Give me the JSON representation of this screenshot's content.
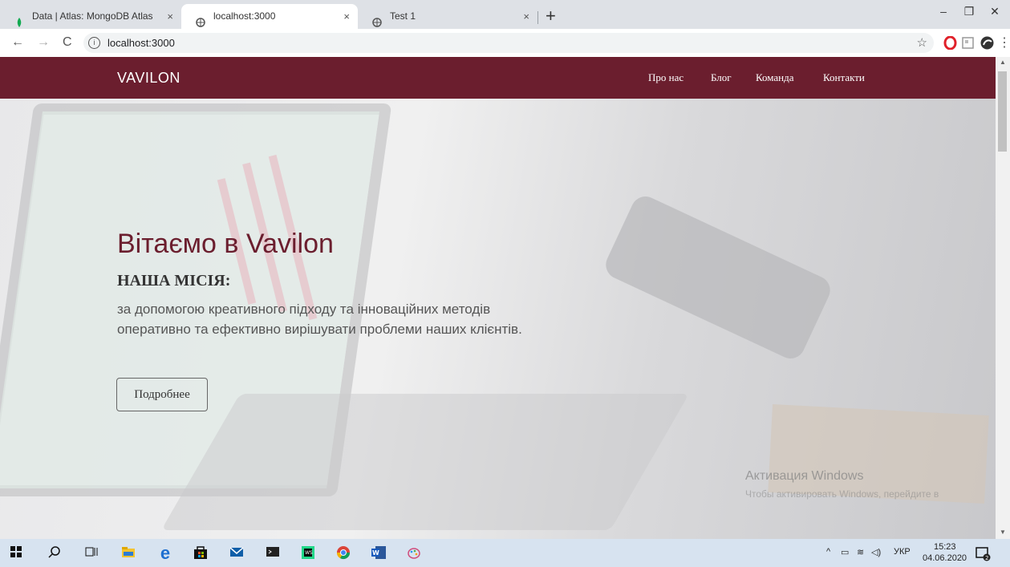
{
  "browser": {
    "tabs": [
      {
        "title": "Data | Atlas: MongoDB Atlas",
        "active": false
      },
      {
        "title": "localhost:3000",
        "active": true
      },
      {
        "title": "Test 1",
        "active": false
      }
    ],
    "new_tab_symbol": "+",
    "url": "localhost:3000",
    "close_symbol": "×",
    "window_controls": {
      "minimize": "–",
      "restore": "❐",
      "close": "✕"
    },
    "nav": {
      "back": "←",
      "forward": "→",
      "reload": "C"
    }
  },
  "page": {
    "brand": "VAVILON",
    "nav_links": [
      "Про нас",
      "Блог",
      "Команда",
      "Контакти"
    ],
    "hero_title": "Вітаємо в Vavilon",
    "mission_title": "НАША МІСІЯ:",
    "mission_text": "за допомогою креативного підходу та інноваційних методів оперативно та ефективно вирішувати проблеми наших клієнтів.",
    "more_button": "Подробнее",
    "colors": {
      "brand": "#6b1e2e"
    }
  },
  "watermark": {
    "title": "Активация Windows",
    "subtitle": "Чтобы активировать Windows, перейдите в"
  },
  "taskbar": {
    "language": "УКР",
    "time": "15:23",
    "date": "04.06.2020",
    "notification_count": "2",
    "icons": [
      "windows-start-icon",
      "search-icon",
      "task-view-icon",
      "file-explorer-icon",
      "edge-icon",
      "store-icon",
      "mail-icon",
      "terminal-icon",
      "webstorm-icon",
      "chrome-icon",
      "word-icon",
      "paint-icon"
    ]
  }
}
